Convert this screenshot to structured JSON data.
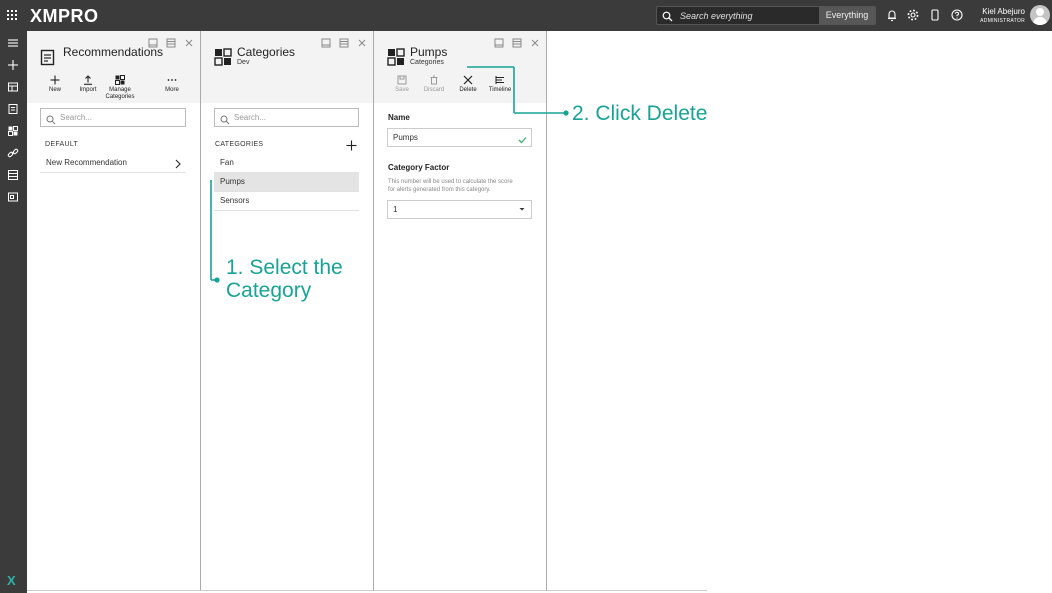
{
  "topbar": {
    "logo": "XMPRO",
    "search_placeholder": "Search everything",
    "search_scope": "Everything",
    "user_name": "Kiel Abejuro",
    "user_role": "ADMINISTRATOR"
  },
  "recommendations": {
    "title": "Recommendations",
    "toolbar": {
      "new": "New",
      "import": "Import",
      "manage_line1": "Manage",
      "manage_line2": "Categories",
      "more": "More"
    },
    "search_placeholder": "Search...",
    "section": "DEFAULT",
    "items": [
      "New Recommendation"
    ]
  },
  "categories": {
    "title": "Categories",
    "subtitle": "Dev",
    "search_placeholder": "Search...",
    "section": "CATEGORIES",
    "items": [
      "Fan",
      "Pumps",
      "Sensors"
    ],
    "selected": "Pumps"
  },
  "pumps": {
    "title": "Pumps",
    "subtitle": "Categories",
    "toolbar": {
      "save": "Save",
      "discard": "Discard",
      "delete": "Delete",
      "timeline": "Timeline"
    },
    "name_label": "Name",
    "name_value": "Pumps",
    "factor_label": "Category Factor",
    "factor_help_line1": "This number will be used to calculate the score",
    "factor_help_line2": "for alerts generated from this category.",
    "factor_value": "1"
  },
  "annotations": {
    "step1_line1": "1. Select the",
    "step1_line2": "Category",
    "step2": "2. Click Delete",
    "color": "#17a395"
  }
}
